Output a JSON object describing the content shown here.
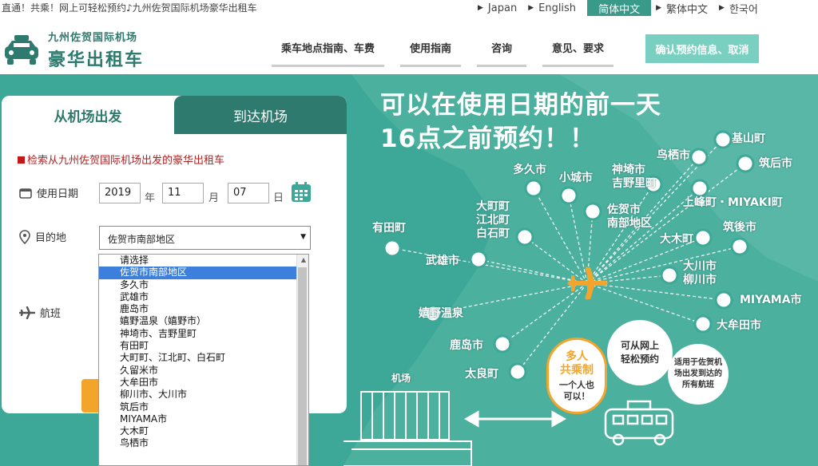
{
  "topbar": {
    "tagline": "直通！共乘！网上可轻松预约♪九州佐贺国际机场豪华出租车",
    "languages": [
      {
        "label": "Japan",
        "active": false
      },
      {
        "label": "English",
        "active": false
      },
      {
        "label": "简体中文",
        "active": true
      },
      {
        "label": "繁体中文",
        "active": false
      },
      {
        "label": "한국어",
        "active": false
      }
    ]
  },
  "header": {
    "logo_sub": "九州佐贺国际机场",
    "logo_main": "豪华出租车",
    "nav": [
      "乘车地点指南、车费",
      "使用指南",
      "咨询",
      "意见、要求"
    ],
    "confirm_button": "确认预约信息、取消"
  },
  "panel": {
    "tab_departure": "从机场出发",
    "tab_arrival": "到达机场",
    "search_title": "检索从九州佐贺国际机场出发的豪华出租车",
    "date_label": "使用日期",
    "year": "2019",
    "year_unit": "年",
    "month": "11",
    "month_unit": "月",
    "day": "07",
    "day_unit": "日",
    "destination_label": "目的地",
    "destination_value": "佐贺市南部地区",
    "flight_label": "航班"
  },
  "dropdown": {
    "options": [
      "请选择",
      "佐贺市南部地区",
      "多久市",
      "武雄市",
      "鹿岛市",
      "嬉野温泉（嬉野市）",
      "神埼市、吉野里町",
      "有田町",
      "大町町、江北町、白石町",
      "久留米市",
      "大牟田市",
      "柳川市、大川市",
      "筑后市",
      "MIYAMA市",
      "大木町",
      "鸟栖市"
    ],
    "selected_index": 1
  },
  "hero": {
    "headline_line1": "可以在使用日期的前一天",
    "headline_line2": "16点之前预约！！",
    "places": [
      "多久市",
      "小城市",
      "神埼市\n吉野里町",
      "鸟栖市",
      "基山町",
      "筑后市",
      "大町町\n江北町\n白石町",
      "佐贺市\n南部地区",
      "上峰町・MIYAKI町",
      "有田町",
      "大木町",
      "筑後市",
      "武雄市",
      "大川市\n柳川市",
      "嬉野温泉",
      "MIYAMA市",
      "大牟田市",
      "鹿岛市",
      "太良町"
    ],
    "airport_label": "机场",
    "bubble_share_title": "多人\n共乘制",
    "bubble_share_sub": "一个人也\n可以！",
    "bubble_online": "可从网上\n轻松预约",
    "bubble_flights": "适用于佐贺机\n场出发到达的\n所有航班"
  },
  "colors": {
    "teal": "#3ea898",
    "dark_teal": "#2e7a6e",
    "accent_orange": "#f2a52a",
    "selected_blue": "#3d7fdc"
  }
}
